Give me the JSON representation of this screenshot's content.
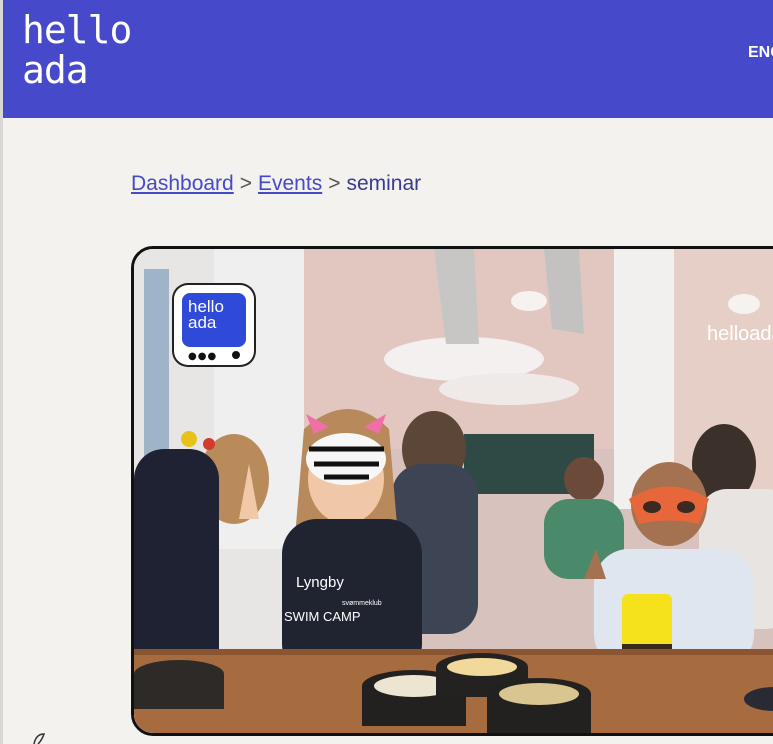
{
  "header": {
    "logo_line1": "hello",
    "logo_line2": "ada",
    "language": "ENG"
  },
  "breadcrumb": {
    "items": [
      {
        "label": "Dashboard"
      },
      {
        "label": "Events"
      }
    ],
    "separator": ">",
    "current": "seminar"
  },
  "hero_image": {
    "badge_line1": "hello",
    "badge_line2": "ada",
    "watermark": "helloada",
    "shirt_text_1": "Lyngby",
    "shirt_text_2": "SWIM CAMP",
    "shirt_text_3": "svømmeklub"
  },
  "colors": {
    "brand": "#4649c9",
    "background": "#f3f2ee"
  }
}
